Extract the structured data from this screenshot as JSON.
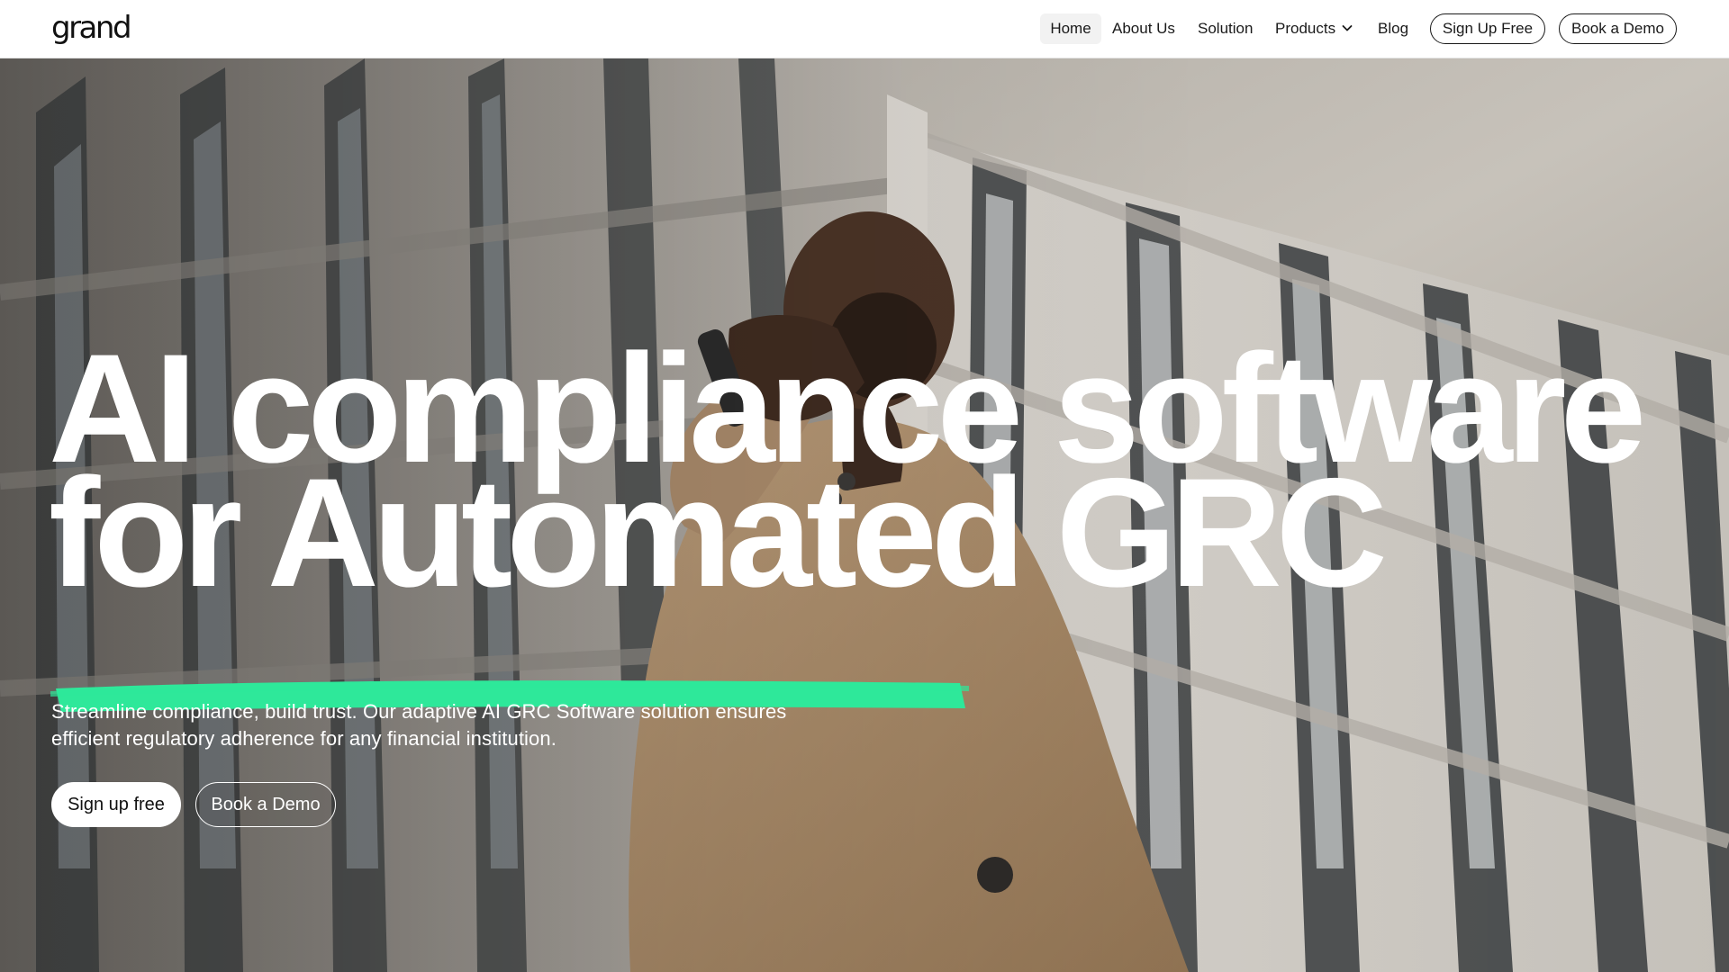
{
  "brand": {
    "logo_text": "grand"
  },
  "nav": {
    "items": [
      {
        "label": "Home",
        "active": true
      },
      {
        "label": "About Us"
      },
      {
        "label": "Solution"
      },
      {
        "label": "Products",
        "has_dropdown": true
      },
      {
        "label": "Blog"
      }
    ],
    "signup_label": "Sign Up Free",
    "demo_label": "Book a Demo"
  },
  "hero": {
    "headline_line1": "AI compliance software",
    "headline_line2": "for Automated GRC",
    "subtext_line1": "Streamline compliance, build trust. Our adaptive AI GRC Software solution ensures",
    "subtext_line2": "efficient regulatory adherence for any financial institution.",
    "primary_cta": "Sign up free",
    "secondary_cta": "Book a Demo",
    "background_image": "photo of man in camel coat on phone in front of office building",
    "highlight_color": "#2ee89a"
  },
  "colors": {
    "accent": "#2ee89a",
    "text_dark": "#111111",
    "hero_text": "#ffffff"
  }
}
